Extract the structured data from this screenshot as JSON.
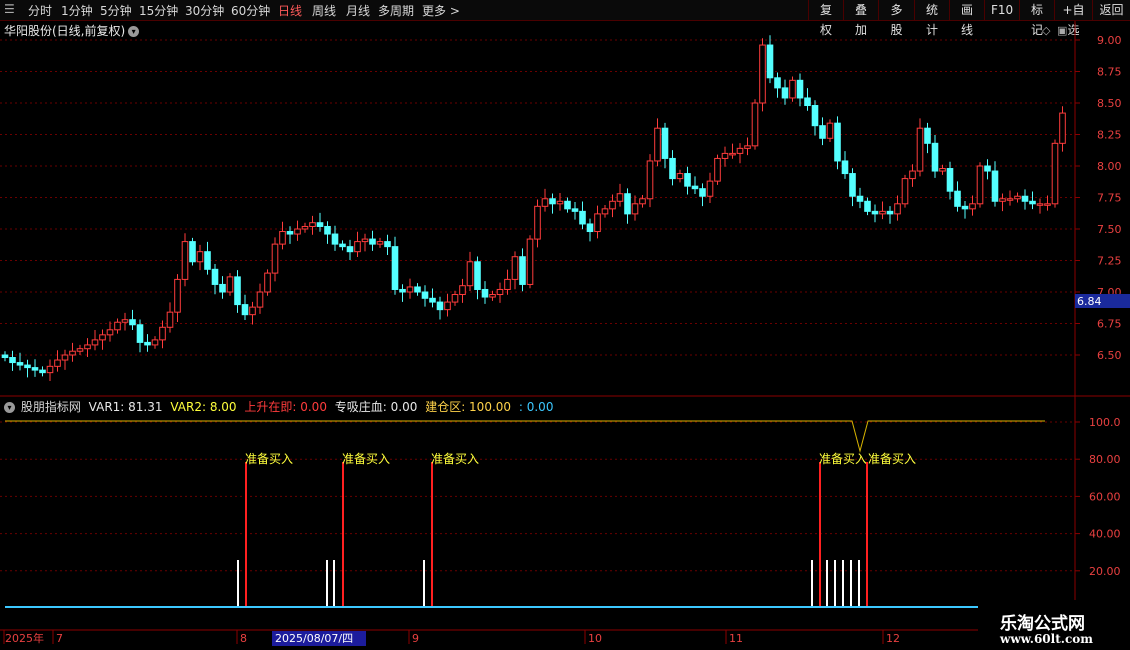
{
  "toolbar": {
    "periods": [
      "分时",
      "1分钟",
      "5分钟",
      "15分钟",
      "30分钟",
      "60分钟",
      "日线",
      "周线",
      "月线",
      "多周期",
      "更多"
    ],
    "active_period": "日线",
    "right_buttons": [
      "复权",
      "叠加",
      "多股",
      "统计",
      "画线",
      "F10",
      "标记",
      "+自选",
      "返回"
    ]
  },
  "stock": {
    "title": "华阳股份(日线,前复权)"
  },
  "price_axis": {
    "ticks": [
      "9.00",
      "8.75",
      "8.50",
      "8.25",
      "8.00",
      "7.75",
      "7.50",
      "7.25",
      "7.00",
      "6.75",
      "6.50"
    ],
    "current_price": "6.84"
  },
  "indicator": {
    "name": "股朋指标网",
    "var1": "VAR1: 81.31",
    "var2": "VAR2: 8.00",
    "rise": "上升在即: 0.00",
    "absorb": "专吸庄血: 0.00",
    "build": "建仓区: 100.00",
    "extra": ": 0.00",
    "axis_ticks": [
      "100.0",
      "80.00",
      "60.00",
      "40.00",
      "20.00"
    ],
    "signal_label": "准备买入"
  },
  "date_axis": {
    "labels": [
      "2025年",
      "7",
      "8",
      "9",
      "10",
      "11",
      "12"
    ],
    "cursor_date": "2025/08/07/四"
  },
  "watermark": {
    "line1": "乐淘公式网",
    "line2": "www.60lt.com"
  },
  "colors": {
    "up": "#ff3c3c",
    "down": "#54ffff",
    "grid": "#6a0000",
    "axis": "#8b0000",
    "yellow": "#ffff3c",
    "baseline": "#3cc8ff"
  }
}
